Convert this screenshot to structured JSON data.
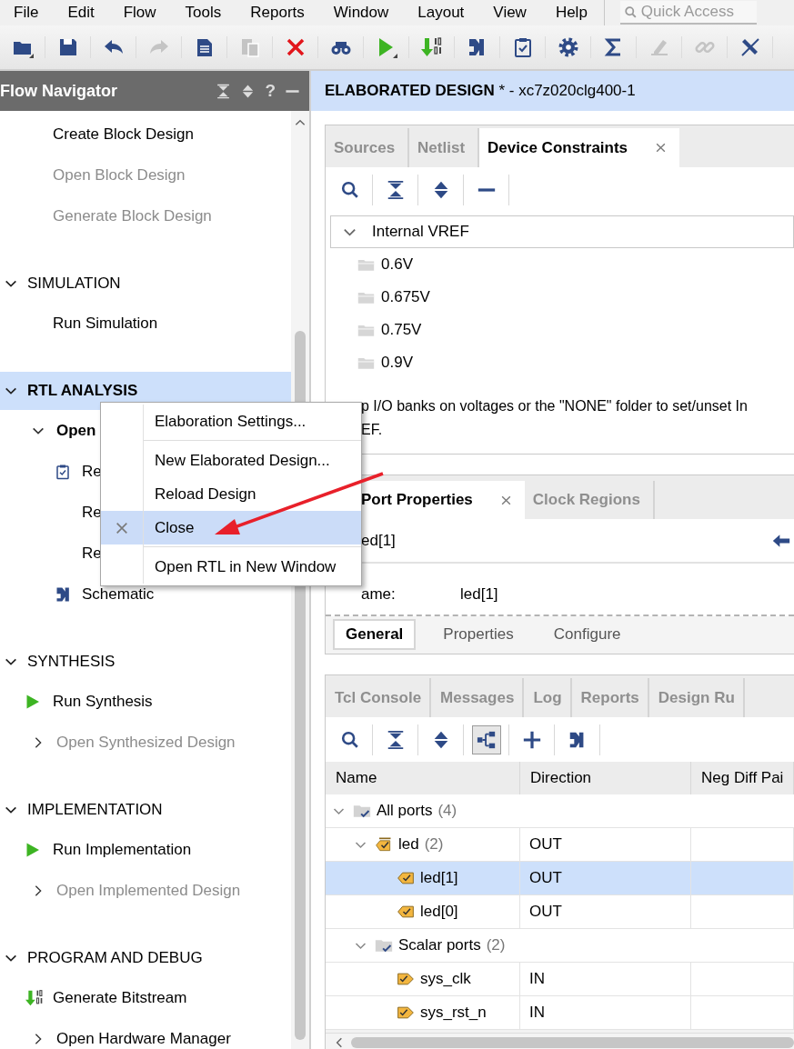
{
  "menu_bar": {
    "items": [
      "File",
      "Edit",
      "Flow",
      "Tools",
      "Reports",
      "Window",
      "Layout",
      "View",
      "Help"
    ],
    "search": {
      "placeholder": "Quick Access"
    }
  },
  "toolbar": [
    {
      "kind": "open",
      "disabled": false
    },
    {
      "kind": "save",
      "disabled": false
    },
    {
      "kind": "undo",
      "disabled": false
    },
    {
      "kind": "redo",
      "disabled": true
    },
    {
      "kind": "copy",
      "disabled": false
    },
    {
      "kind": "paste",
      "disabled": true
    },
    {
      "kind": "delete",
      "disabled": false
    },
    {
      "kind": "find",
      "disabled": false
    },
    {
      "kind": "run",
      "disabled": false
    },
    {
      "kind": "bitstream",
      "disabled": false
    },
    {
      "kind": "schematic",
      "disabled": false
    },
    {
      "kind": "report",
      "disabled": false
    },
    {
      "kind": "settings",
      "disabled": false
    },
    {
      "kind": "sum",
      "disabled": false
    },
    {
      "kind": "probe",
      "disabled": true
    },
    {
      "kind": "link",
      "disabled": true
    },
    {
      "kind": "unlink",
      "disabled": false
    }
  ],
  "flow_navigator": {
    "title": "Flow Navigator",
    "help": "?",
    "sections": [
      {
        "items": [
          {
            "label": "Create Block Design",
            "kind": "task",
            "disabled": false
          },
          {
            "label": "Open Block Design",
            "kind": "task",
            "disabled": true
          },
          {
            "label": "Generate Block Design",
            "kind": "task",
            "disabled": true
          }
        ]
      },
      {
        "title": "SIMULATION",
        "expanded": true,
        "selected": false,
        "items": [
          {
            "label": "Run Simulation",
            "kind": "task",
            "disabled": false
          }
        ]
      },
      {
        "title": "RTL ANALYSIS",
        "expanded": true,
        "selected": true,
        "items": [
          {
            "label": "Open",
            "kind": "group",
            "expanded": true,
            "current": true,
            "disabled": false,
            "children": [
              {
                "label": "Re",
                "kind": "report",
                "disabled": false
              },
              {
                "label": "Re",
                "kind": "task",
                "disabled": false
              },
              {
                "label": "Re",
                "kind": "task",
                "disabled": false
              },
              {
                "label": "Schematic",
                "kind": "schematic",
                "disabled": false
              }
            ]
          }
        ]
      },
      {
        "title": "SYNTHESIS",
        "expanded": true,
        "selected": false,
        "items": [
          {
            "label": "Run Synthesis",
            "kind": "run",
            "disabled": false
          },
          {
            "label": "Open Synthesized Design",
            "kind": "group",
            "expanded": false,
            "current": false,
            "disabled": true
          }
        ]
      },
      {
        "title": "IMPLEMENTATION",
        "expanded": true,
        "selected": false,
        "items": [
          {
            "label": "Run Implementation",
            "kind": "run",
            "disabled": false
          },
          {
            "label": "Open Implemented Design",
            "kind": "group",
            "expanded": false,
            "current": false,
            "disabled": true
          }
        ]
      },
      {
        "title": "PROGRAM AND DEBUG",
        "expanded": true,
        "selected": false,
        "items": [
          {
            "label": "Generate Bitstream",
            "kind": "bitstream",
            "disabled": false
          },
          {
            "label": "Open Hardware Manager",
            "kind": "group",
            "expanded": false,
            "current": false,
            "disabled": false
          }
        ]
      }
    ]
  },
  "design_header": "**ELABORATED DESIGN** * - xc7z020clg400-1",
  "constraints_panel": {
    "tabs": [
      {
        "label": "Sources",
        "selected": false,
        "closable": false
      },
      {
        "label": "Netlist",
        "selected": false,
        "closable": false
      },
      {
        "label": "Device Constraints",
        "selected": true,
        "closable": true
      }
    ],
    "toolbar": [
      {
        "kind": "search"
      },
      {
        "kind": "collapse"
      },
      {
        "kind": "expand"
      },
      {
        "kind": "minus"
      }
    ],
    "tree": {
      "label": "Internal VREF",
      "expanded": true,
      "children": [
        "0.6V",
        "0.675V",
        "0.75V",
        "0.9V"
      ]
    },
    "hint_lines": [
      "p I/O banks on voltages or the \"NONE\" folder to set/unset In",
      "EF."
    ]
  },
  "properties_panel": {
    "tabs": [
      {
        "label": "Port Properties",
        "selected": true,
        "closable": true
      },
      {
        "label": "Clock Regions",
        "selected": false,
        "closable": false
      }
    ],
    "object": "ed[1]",
    "field": {
      "label": "ame:",
      "value": "led[1]"
    },
    "sub_tabs": [
      {
        "label": "General",
        "selected": true
      },
      {
        "label": "Properties",
        "selected": false
      },
      {
        "label": "Configure",
        "selected": false
      }
    ]
  },
  "console_panel": {
    "tabs": [
      {
        "label": "Tcl Console",
        "selected": false
      },
      {
        "label": "Messages",
        "selected": false
      },
      {
        "label": "Log",
        "selected": false
      },
      {
        "label": "Reports",
        "selected": false
      },
      {
        "label": "Design Ru",
        "selected": false
      }
    ],
    "toolbar": [
      {
        "kind": "search",
        "on": false
      },
      {
        "kind": "collapse",
        "on": false
      },
      {
        "kind": "expand",
        "on": false
      },
      {
        "kind": "hierarchy",
        "on": true
      },
      {
        "kind": "add",
        "on": false
      },
      {
        "kind": "schematic",
        "on": false
      }
    ],
    "table": {
      "columns": [
        "Name",
        "Direction",
        "Neg Diff Pai"
      ],
      "rows": [
        {
          "name": "All ports",
          "count": "(4)",
          "kind": "folder",
          "expanded": true,
          "selected": false,
          "children": [
            {
              "name": "led",
              "count": "(2)",
              "direction": "OUT",
              "kind": "output_bus",
              "expanded": true,
              "selected": false,
              "children": [
                {
                  "name": "led[1]",
                  "direction": "OUT",
                  "kind": "output",
                  "selected": true
                },
                {
                  "name": "led[0]",
                  "direction": "OUT",
                  "kind": "output",
                  "selected": false
                }
              ]
            },
            {
              "name": "Scalar ports",
              "count": "(2)",
              "kind": "folder",
              "expanded": true,
              "selected": false,
              "children": [
                {
                  "name": "sys_clk",
                  "direction": "IN",
                  "kind": "input",
                  "selected": false
                },
                {
                  "name": "sys_rst_n",
                  "direction": "IN",
                  "kind": "input",
                  "selected": false
                }
              ]
            }
          ]
        }
      ]
    }
  },
  "context_menu": {
    "items": [
      {
        "kind": "item",
        "label": "Elaboration Settings...",
        "selected": false
      },
      {
        "kind": "separator"
      },
      {
        "kind": "item",
        "label": "New Elaborated Design...",
        "selected": false
      },
      {
        "kind": "item",
        "label": "Reload Design",
        "selected": false
      },
      {
        "kind": "icon_item",
        "label": "Close",
        "selected": true
      },
      {
        "kind": "separator"
      },
      {
        "kind": "item",
        "label": "Open RTL in New Window",
        "selected": false
      }
    ]
  }
}
